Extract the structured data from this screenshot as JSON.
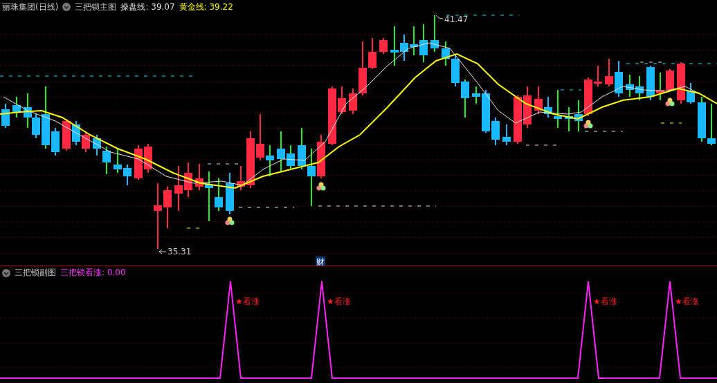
{
  "main_panel": {
    "symbol": "丽珠集团(日线)",
    "indicator": "三把锁主图",
    "lines": [
      {
        "label": "操盘线:",
        "value": "39.07",
        "color": "#e0e0e0"
      },
      {
        "label": "黄金线:",
        "value": "39.22",
        "color": "#ffff00"
      }
    ],
    "high_label": "41.47",
    "low_label": "35.31",
    "badge": "财"
  },
  "sub_panel": {
    "indicator": "三把锁副图",
    "line": {
      "label": "三把锁看涨:",
      "value": "0.00"
    },
    "signals": [
      {
        "label": "★看涨"
      },
      {
        "label": "★看涨"
      },
      {
        "label": "★看涨"
      },
      {
        "label": "★看涨"
      }
    ]
  }
}
